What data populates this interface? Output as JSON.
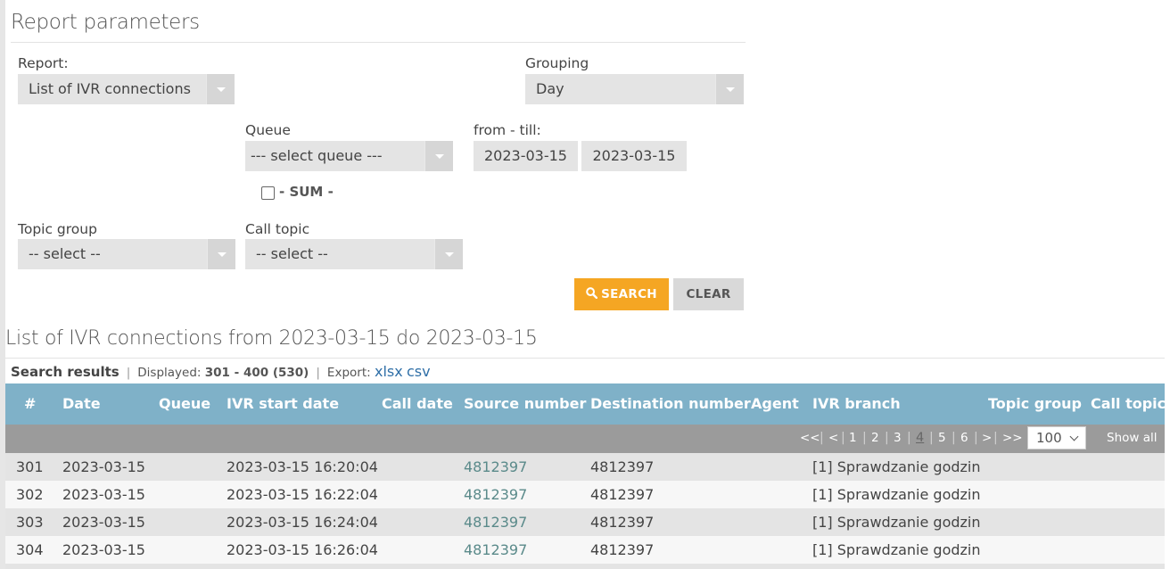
{
  "params": {
    "title": "Report parameters",
    "report_label": "Report:",
    "report_value": "List of IVR connections",
    "grouping_label": "Grouping",
    "grouping_value": "Day",
    "queue_label": "Queue",
    "queue_value": "--- select queue ---",
    "from_till_label": "from - till:",
    "date_from": "2023-03-15",
    "date_till": "2023-03-15",
    "sum_label": "- SUM -",
    "topic_group_label": "Topic group",
    "topic_group_value": "-- select --",
    "call_topic_label": "Call topic",
    "call_topic_value": "-- select --",
    "search_label": "SEARCH",
    "clear_label": "CLEAR"
  },
  "list": {
    "title": "List of IVR connections from 2023-03-15 do 2023-03-15",
    "results_label": "Search results",
    "displayed_label": "Displayed:",
    "displayed_value": "301 - 400 (530)",
    "export_label": "Export:",
    "export_xlsx": "xlsx",
    "export_csv": "csv"
  },
  "table": {
    "columns": [
      "#",
      "Date",
      "Queue",
      "IVR start date",
      "Call date",
      "Source number",
      "Destination number",
      "Agent",
      "IVR branch",
      "Topic group",
      "Call topic"
    ],
    "rows": [
      [
        "301",
        "2023-03-15",
        "",
        "2023-03-15 16:20:04",
        "",
        "4812397",
        "4812397",
        "",
        "[1] Sprawdzanie godzin",
        "",
        ""
      ],
      [
        "302",
        "2023-03-15",
        "",
        "2023-03-15 16:22:04",
        "",
        "4812397",
        "4812397",
        "",
        "[1] Sprawdzanie godzin",
        "",
        ""
      ],
      [
        "303",
        "2023-03-15",
        "",
        "2023-03-15 16:24:04",
        "",
        "4812397",
        "4812397",
        "",
        "[1] Sprawdzanie godzin",
        "",
        ""
      ],
      [
        "304",
        "2023-03-15",
        "",
        "2023-03-15 16:26:04",
        "",
        "4812397",
        "4812397",
        "",
        "[1] Sprawdzanie godzin",
        "",
        ""
      ]
    ]
  },
  "pager": {
    "first": "<<",
    "prev": "<",
    "pages": [
      "1",
      "2",
      "3",
      "4",
      "5",
      "6"
    ],
    "current": "4",
    "next": ">",
    "last": ">>",
    "per_page": "100",
    "show_all": "Show all"
  },
  "icons": {
    "search": "search-icon",
    "dropdown": "chevron-down-icon"
  },
  "colors": {
    "accent": "#f5a623",
    "header": "#7fb1c8",
    "pager": "#9b9b9b",
    "link": "#2f6fa7"
  }
}
